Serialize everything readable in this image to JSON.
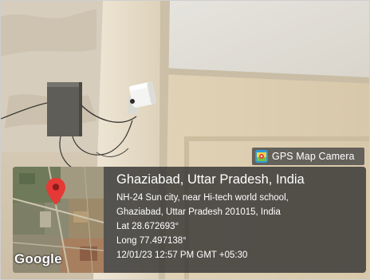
{
  "badge": {
    "label": "GPS Map Camera",
    "icon": "gps-map-camera-app-icon"
  },
  "location": {
    "title": "Ghaziabad, Uttar Pradesh, India",
    "address_line_1": "NH-24 Sun city, near Hi-tech world school,",
    "address_line_2": "Ghaziabad, Uttar Pradesh 201015, India",
    "latitude": "Lat 28.672693°",
    "longitude": "Long 77.497138°",
    "timestamp": "12/01/23 12:57 PM GMT +05:30"
  },
  "map": {
    "attribution": "Google",
    "pin_color": "#e53935"
  },
  "colors": {
    "overlay_background": "#303030",
    "text": "#ffffff"
  }
}
